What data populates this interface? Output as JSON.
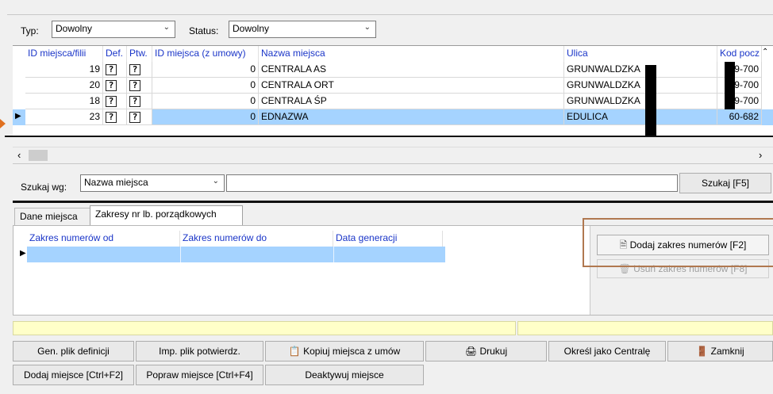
{
  "filter": {
    "type_label": "Typ:",
    "type_value": "Dowolny",
    "status_label": "Status:",
    "status_value": "Dowolny"
  },
  "grid": {
    "headers": [
      "ID miejsca/filii",
      "Def.",
      "Ptw.",
      "ID miejsca (z umowy)",
      "Nazwa miejsca",
      "Ulica",
      "Kod pocz"
    ],
    "rows": [
      {
        "id": "19",
        "def": "?",
        "ptw": "?",
        "id_umowy": "0",
        "nazwa": "CENTRALA AS",
        "ulica": "GRUNWALDZKA",
        "kod": "9-700"
      },
      {
        "id": "20",
        "def": "?",
        "ptw": "?",
        "id_umowy": "0",
        "nazwa": "CENTRALA ORT",
        "ulica": "GRUNWALDZKA",
        "kod": "9-700"
      },
      {
        "id": "18",
        "def": "?",
        "ptw": "?",
        "id_umowy": "0",
        "nazwa": "CENTRALA ŚP",
        "ulica": "GRUNWALDZKA",
        "kod": "9-700"
      },
      {
        "id": "23",
        "def": "?",
        "ptw": "?",
        "id_umowy": "0",
        "nazwa": "EDNAZWA",
        "ulica": "EDULICA",
        "kod": "60-682"
      }
    ]
  },
  "search": {
    "label": "Szukaj wg:",
    "field_value": "Nazwa miejsca",
    "query": "",
    "button": "Szukaj [F5]"
  },
  "tabs": {
    "dane": "Dane miejsca",
    "zakresy": "Zakresy nr lb. porządkowych"
  },
  "ranges_grid": {
    "headers": [
      "Zakres numerów od",
      "Zakres numerów do",
      "Data generacji"
    ]
  },
  "range_buttons": {
    "add": "Dodaj zakres numerów [F2]",
    "remove": "Usuń zakres numerów [F8]"
  },
  "bottom_buttons": {
    "gen_def": "Gen. plik definicji",
    "imp_potw": "Imp. plik potwierdz.",
    "kopiuj": "Kopiuj miejsca z umów",
    "drukuj": "Drukuj",
    "centrala": "Określ jako Centralę",
    "zamknij": "Zamknij",
    "dodaj": "Dodaj miejsce [Ctrl+F2]",
    "popraw": "Popraw miejsce [Ctrl+F4]",
    "deaktywuj": "Deaktywuj miejsce"
  },
  "colors": {
    "selection": "#a5d3ff",
    "header_text": "#1a35c8",
    "status_bar": "#ffffc8",
    "highlight_border": "#b07850"
  }
}
